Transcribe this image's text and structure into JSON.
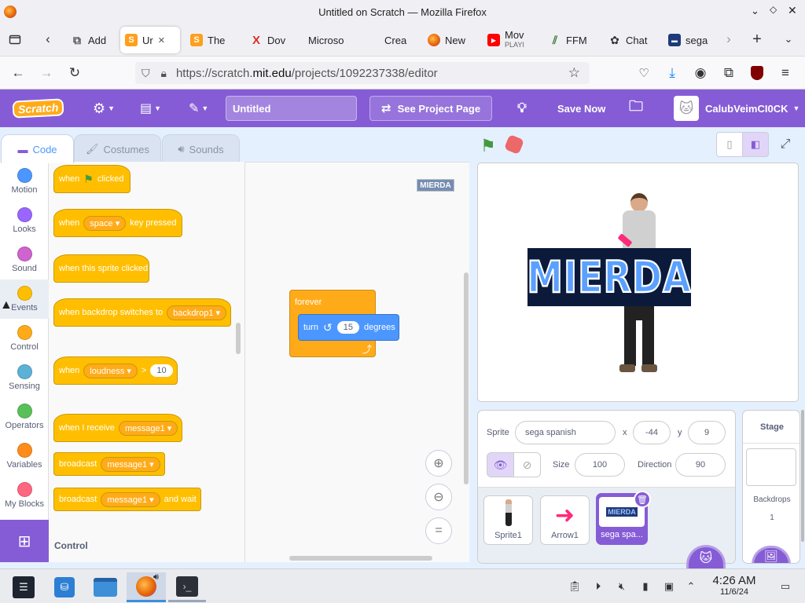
{
  "window": {
    "title": "Untitled on Scratch — Mozilla Firefox"
  },
  "tabs": [
    {
      "label": "Add",
      "icon": "puzzle-icon",
      "color": "#555555"
    },
    {
      "label": "Ur",
      "icon": "scratch-icon",
      "color": "#ff9f1c"
    },
    {
      "label": "The",
      "icon": "scratch-icon",
      "color": "#ff9f1c"
    },
    {
      "label": "Dov",
      "icon": "x-icon",
      "color": "#d93025"
    },
    {
      "label": "Microso",
      "icon": "",
      "color": ""
    },
    {
      "label": "Crea",
      "icon": "microsoft-icon",
      "color": "#f25022"
    },
    {
      "label": "New",
      "icon": "firefox-icon",
      "color": "#e66000"
    },
    {
      "label": "Mov",
      "sublabel": "PLAYI",
      "icon": "youtube-icon",
      "color": "#ff0000"
    },
    {
      "label": "FFM",
      "icon": "ffmpeg-icon",
      "color": "#3a7d3a"
    },
    {
      "label": "Chat",
      "icon": "chatgpt-icon",
      "color": "#333333"
    },
    {
      "label": "sega",
      "icon": "sega-icon",
      "color": "#1f3a7a"
    }
  ],
  "url": {
    "prefix": "https://scratch.",
    "domain": "mit.edu",
    "path": "/projects/1092237338/editor"
  },
  "menubar": {
    "logo": "Scratch",
    "project_title": "Untitled",
    "see_project": "See Project Page",
    "save_now": "Save Now",
    "username": "CalubVeimCI0CK",
    "color": "#855cd6"
  },
  "editor_tabs": {
    "code": "Code",
    "costumes": "Costumes",
    "sounds": "Sounds"
  },
  "categories": [
    {
      "label": "Motion",
      "color": "#4c97ff"
    },
    {
      "label": "Looks",
      "color": "#9966ff"
    },
    {
      "label": "Sound",
      "color": "#cf63cf"
    },
    {
      "label": "Events",
      "color": "#ffbf00"
    },
    {
      "label": "Control",
      "color": "#ffab19"
    },
    {
      "label": "Sensing",
      "color": "#5cb1d6"
    },
    {
      "label": "Operators",
      "color": "#59c059"
    },
    {
      "label": "Variables",
      "color": "#ff8c1a"
    },
    {
      "label": "My Blocks",
      "color": "#ff6680"
    }
  ],
  "palette": {
    "flag_clicked": {
      "when": "when",
      "clicked": "clicked"
    },
    "key_pressed": {
      "when": "when",
      "key": "space",
      "rest": "key pressed"
    },
    "sprite_clicked": "when this sprite clicked",
    "backdrop_switch": {
      "text": "when backdrop switches to",
      "value": "backdrop1"
    },
    "loudness": {
      "when": "when",
      "key": "loudness",
      "op": ">",
      "value": "10"
    },
    "receive": {
      "text": "when I receive",
      "value": "message1"
    },
    "broadcast": {
      "text": "broadcast",
      "value": "message1"
    },
    "broadcast_wait": {
      "text": "broadcast",
      "value": "message1",
      "rest": "and wait"
    },
    "next_section": "Control"
  },
  "script": {
    "forever": "forever",
    "turn": "turn",
    "degrees_value": "15",
    "degrees": "degrees"
  },
  "stage_watermark": "MIERDA",
  "stage_banner": "MIERDA",
  "sprite_info": {
    "sprite_label": "Sprite",
    "name": "sega spanish",
    "x_label": "x",
    "x": "-44",
    "y_label": "y",
    "y": "9",
    "show_label": "Show",
    "size_label": "Size",
    "size": "100",
    "direction_label": "Direction",
    "direction": "90"
  },
  "sprites": [
    {
      "name": "Sprite1"
    },
    {
      "name": "Arrow1"
    },
    {
      "name": "sega spa..."
    }
  ],
  "stage_panel": {
    "title": "Stage",
    "backdrops_label": "Backdrops",
    "backdrops_count": "1"
  },
  "clock": {
    "time": "4:26 AM",
    "date": "11/6/24"
  }
}
